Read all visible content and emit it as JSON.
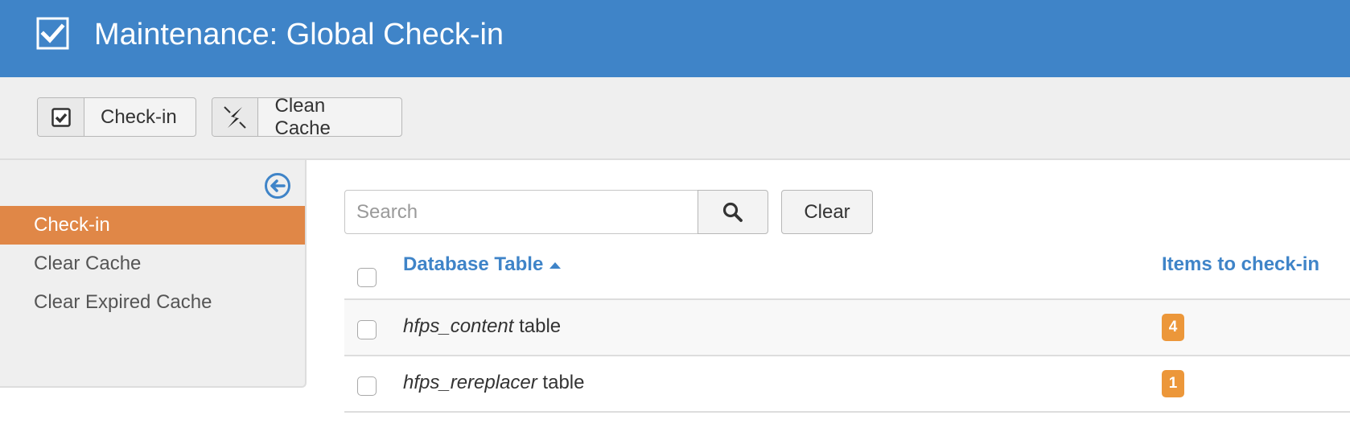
{
  "header": {
    "icon": "checkbox-checked-icon",
    "title": "Maintenance: Global Check-in"
  },
  "toolbar": {
    "buttons": [
      {
        "icon": "checkbox-checked-icon",
        "label": "Check-in"
      },
      {
        "icon": "lightning-icon",
        "label": "Clean Cache"
      }
    ]
  },
  "sidebar": {
    "collapse_icon": "arrow-left-circle-icon",
    "items": [
      {
        "label": "Check-in",
        "active": true
      },
      {
        "label": "Clear Cache",
        "active": false
      },
      {
        "label": "Clear Expired Cache",
        "active": false
      }
    ]
  },
  "search": {
    "placeholder": "Search",
    "value": "",
    "search_icon": "search-icon",
    "clear_label": "Clear"
  },
  "table": {
    "columns": [
      {
        "label": "Database Table",
        "sort": "ascending"
      },
      {
        "label": "Items to check-in"
      }
    ],
    "rows": [
      {
        "table_name": "hfps_content",
        "suffix": " table",
        "items": "4"
      },
      {
        "table_name": "hfps_rereplacer",
        "suffix": " table",
        "items": "1"
      }
    ]
  },
  "colors": {
    "header_bg": "#3f84c8",
    "active_item": "#e08747",
    "badge": "#ec973a",
    "link": "#3f84c8"
  }
}
